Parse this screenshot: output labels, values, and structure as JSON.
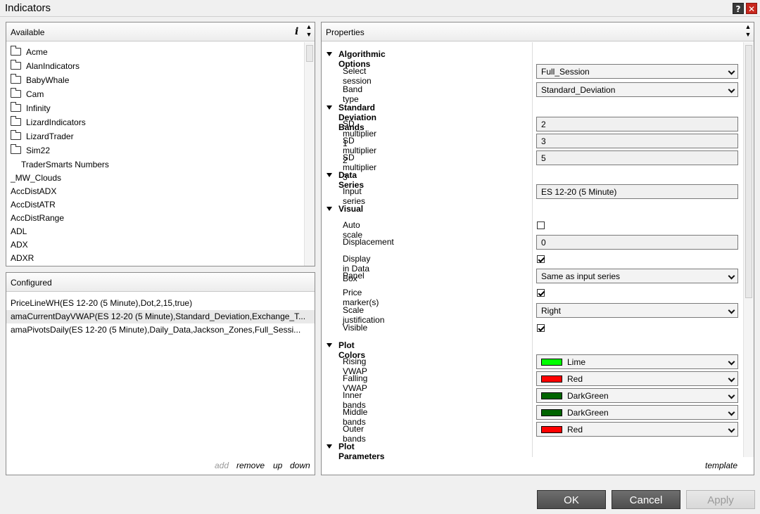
{
  "window": {
    "title": "Indicators",
    "help_glyph": "?",
    "close_glyph": "✕"
  },
  "available": {
    "header": "Available",
    "info_glyph": "i",
    "scroll_up_glyph": "▲",
    "scroll_down_glyph": "▼",
    "folders": [
      "Acme",
      "AlanIndicators",
      "BabyWhale",
      "Cam",
      "Infinity",
      "LizardIndicators",
      "LizardTrader",
      "Sim22"
    ],
    "subitem": "TraderSmarts Numbers",
    "items": [
      "_MW_Clouds",
      "AccDistADX",
      "AccDistATR",
      "AccDistRange",
      "ADL",
      "ADX",
      "ADXR"
    ]
  },
  "configured": {
    "header": "Configured",
    "rows": [
      "PriceLineWH(ES 12-20 (5 Minute),Dot,2,15,true)",
      "amaCurrentDayVWAP(ES 12-20 (5 Minute),Standard_Deviation,Exchange_T...",
      "amaPivotsDaily(ES 12-20 (5 Minute),Daily_Data,Jackson_Zones,Full_Sessi..."
    ],
    "actions": {
      "add": "add",
      "remove": "remove",
      "up": "up",
      "down": "down"
    }
  },
  "properties": {
    "header": "Properties",
    "template_link": "template",
    "categories": {
      "algorithmic": "Algorithmic Options",
      "sd_bands": "Standard Deviation Bands",
      "data_series": "Data Series",
      "visual": "Visual",
      "plot_colors": "Plot Colors",
      "plot_params": "Plot Parameters"
    },
    "labels": {
      "select_session": "Select session",
      "band_type": "Band type",
      "sd1": "SD multiplier 1",
      "sd2": "SD multiplier 2",
      "sd3": "SD multiplier 3",
      "input_series": "Input series",
      "auto_scale": "Auto scale",
      "displacement": "Displacement",
      "display_data_box": "Display in Data Box",
      "panel": "Panel",
      "price_markers": "Price marker(s)",
      "scale_justification": "Scale justification",
      "visible": "Visible",
      "rising_vwap": "Rising VWAP",
      "falling_vwap": "Falling VWAP",
      "inner_bands": "Inner bands",
      "middle_bands": "Middle bands",
      "outer_bands": "Outer bands"
    },
    "values": {
      "select_session": "Full_Session",
      "band_type": "Standard_Deviation",
      "sd1": "2",
      "sd2": "3",
      "sd3": "5",
      "input_series": "ES 12-20 (5 Minute)",
      "auto_scale": false,
      "displacement": "0",
      "display_data_box": true,
      "panel": "Same as input series",
      "price_markers": true,
      "scale_justification": "Right",
      "visible": true,
      "rising_vwap": "Lime",
      "falling_vwap": "Red",
      "inner_bands": "DarkGreen",
      "middle_bands": "DarkGreen",
      "outer_bands": "Red"
    },
    "colors": {
      "Lime": "#00ff00",
      "Red": "#ff0000",
      "DarkGreen": "#006400"
    }
  },
  "buttons": {
    "ok": "OK",
    "cancel": "Cancel",
    "apply": "Apply"
  }
}
